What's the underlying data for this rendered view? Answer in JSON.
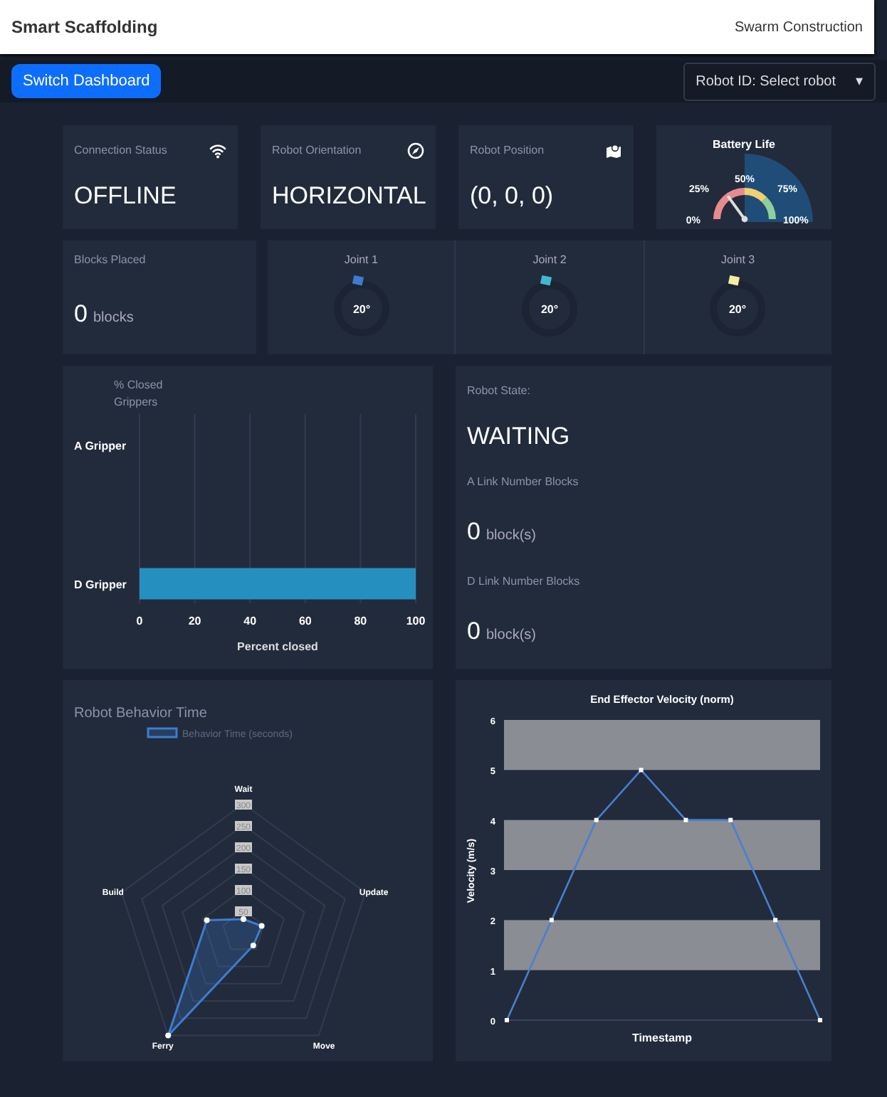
{
  "navbar": {
    "brand": "Smart Scaffolding",
    "link": "Swarm Construction"
  },
  "toolbar": {
    "button": "Switch Dashboard",
    "select": "Robot ID: Select robot",
    "caret": "▾"
  },
  "status_cards": [
    {
      "kind": "wifi",
      "label": "Connection Status",
      "value": "OFFLINE"
    },
    {
      "kind": "compass",
      "label": "Robot Orientation",
      "value": "HORIZONTAL"
    },
    {
      "kind": "map",
      "label": "Robot Position",
      "value": "(0, 0, 0)"
    }
  ],
  "battery": {
    "title": "Battery Life",
    "ticks": [
      "0%",
      "25%",
      "50%",
      "75%",
      "100%"
    ]
  },
  "blocks_placed": {
    "label": "Blocks Placed",
    "value": "0",
    "unit": "blocks"
  },
  "joints": [
    {
      "name": "Joint 1",
      "value": "20°",
      "color": "#3d7dd0"
    },
    {
      "name": "Joint 2",
      "value": "20°",
      "color": "#3fb8d0"
    },
    {
      "name": "Joint 3",
      "value": "20°",
      "color": "#f3eea0"
    }
  ],
  "grippers": {
    "chart_data": {
      "type": "bar",
      "orientation": "horizontal",
      "title": "% Closed Grippers",
      "xlabel": "Percent closed",
      "categories": [
        "A Gripper",
        "D Gripper"
      ],
      "series": [
        {
          "color": "#2590c0",
          "values": [
            0,
            100
          ]
        }
      ],
      "xlim": [
        0,
        100
      ],
      "xticks": [
        0,
        20,
        40,
        60,
        80,
        100
      ],
      "grid": true
    }
  },
  "robot_state": {
    "label": "Robot State:",
    "value": "WAITING",
    "counts": [
      {
        "label": "A Link Number Blocks",
        "value": "0",
        "unit": "block(s)"
      },
      {
        "label": "D Link Number Blocks",
        "value": "0",
        "unit": "block(s)"
      }
    ]
  },
  "behavior": {
    "title": "Robot Behavior Time",
    "legend": "Behavior Time (seconds)",
    "axes": [
      "Wait",
      "Update",
      "Move",
      "Ferry",
      "Build"
    ],
    "ticks": [
      "300",
      "250",
      "200",
      "150",
      "100",
      "50"
    ]
  },
  "velocity": {
    "chart_data": {
      "type": "line",
      "title": "End Effector Velocity (norm)",
      "xlabel": "Timestamp",
      "ylabel": "Velocity (m/s)",
      "series": [
        {
          "color": "#4a7fd0",
          "marker": "square",
          "values": [
            0,
            2,
            4,
            5,
            4,
            4,
            2,
            0
          ]
        }
      ],
      "ylim": [
        0,
        6
      ],
      "yticks": [
        0,
        1,
        2,
        3,
        4,
        5,
        6
      ]
    }
  }
}
